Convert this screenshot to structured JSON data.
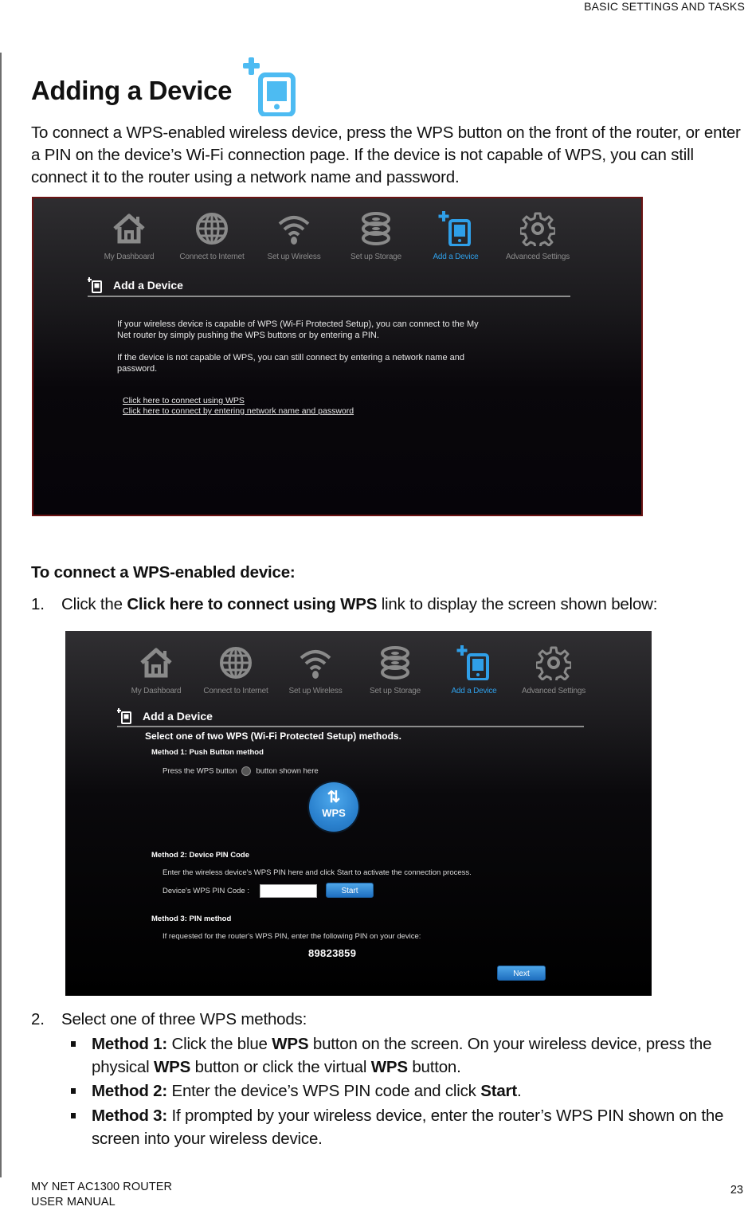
{
  "header": {
    "section": "BASIC SETTINGS AND TASKS"
  },
  "title": "Adding a Device",
  "intro": "To connect a WPS-enabled wireless device, press the WPS button on the front of the router, or enter a PIN on the device’s Wi-Fi connection page. If the device is not capable of WPS, you can still connect it to the router using a network name and password.",
  "colors": {
    "accent": "#2f9fe8",
    "frame": "#6b1414",
    "nav_inactive": "#8a8a8a"
  },
  "nav": {
    "items": [
      {
        "label": "My Dashboard",
        "icon": "home-icon",
        "active": false
      },
      {
        "label": "Connect to Internet",
        "icon": "globe-icon",
        "active": false
      },
      {
        "label": "Set up Wireless",
        "icon": "wifi-icon",
        "active": false
      },
      {
        "label": "Set up Storage",
        "icon": "storage-icon",
        "active": false
      },
      {
        "label": "Add a Device",
        "icon": "add-device-icon",
        "active": true
      },
      {
        "label": "Advanced Settings",
        "icon": "gear-icon",
        "active": false
      }
    ]
  },
  "screen1": {
    "section_title": "Add a Device",
    "para1": "If your wireless device is capable of WPS (Wi-Fi Protected Setup), you can connect to the My Net router by simply pushing the WPS buttons or by entering a PIN.",
    "para2": "If the device is not capable of WPS, you can still connect by entering a network name and password.",
    "link_wps": "Click here to connect using WPS",
    "link_manual": "Click here to connect by entering network name and password"
  },
  "subheading": "To connect a WPS-enabled device:",
  "step1": {
    "num": "1.",
    "pre": "Click the ",
    "bold": "Click here to connect using WPS",
    "post": " link to display the screen shown below:"
  },
  "screen2": {
    "section_title": "Add a Device",
    "heading": "Select one of two WPS (Wi-Fi Protected Setup) methods.",
    "method1_title": "Method 1: Push Button method",
    "method1_text_pre": "Press the WPS button",
    "method1_text_post": "button shown here",
    "wps_button": "WPS",
    "method2_title": "Method 2: Device PIN Code",
    "method2_text": "Enter the wireless device's WPS PIN here and click Start to activate the connection process.",
    "pin_label": "Device's WPS PIN Code :",
    "pin_value": "",
    "start_button": "Start",
    "method3_title": "Method 3: PIN method",
    "method3_text": "If requested for the router's WPS PIN, enter the following PIN on your device:",
    "router_pin": "89823859",
    "next_button": "Next"
  },
  "step2": {
    "num": "2.",
    "text": "Select one of three WPS methods:",
    "bullets": [
      {
        "lead": "Method 1:",
        "parts": [
          " Click the blue ",
          "WPS",
          " button on the screen. On your wireless device, press the physical ",
          "WPS",
          " button or click the virtual ",
          "WPS",
          " button."
        ]
      },
      {
        "lead": "Method 2:",
        "parts": [
          " Enter the device’s WPS PIN code and click ",
          "Start",
          "."
        ]
      },
      {
        "lead": "Method 3:",
        "parts": [
          " If prompted by your wireless device, enter the router’s WPS PIN shown on the screen into your wireless device."
        ]
      }
    ]
  },
  "footer": {
    "line1": "MY NET AC1300 ROUTER",
    "line2": "USER MANUAL",
    "page": "23"
  }
}
